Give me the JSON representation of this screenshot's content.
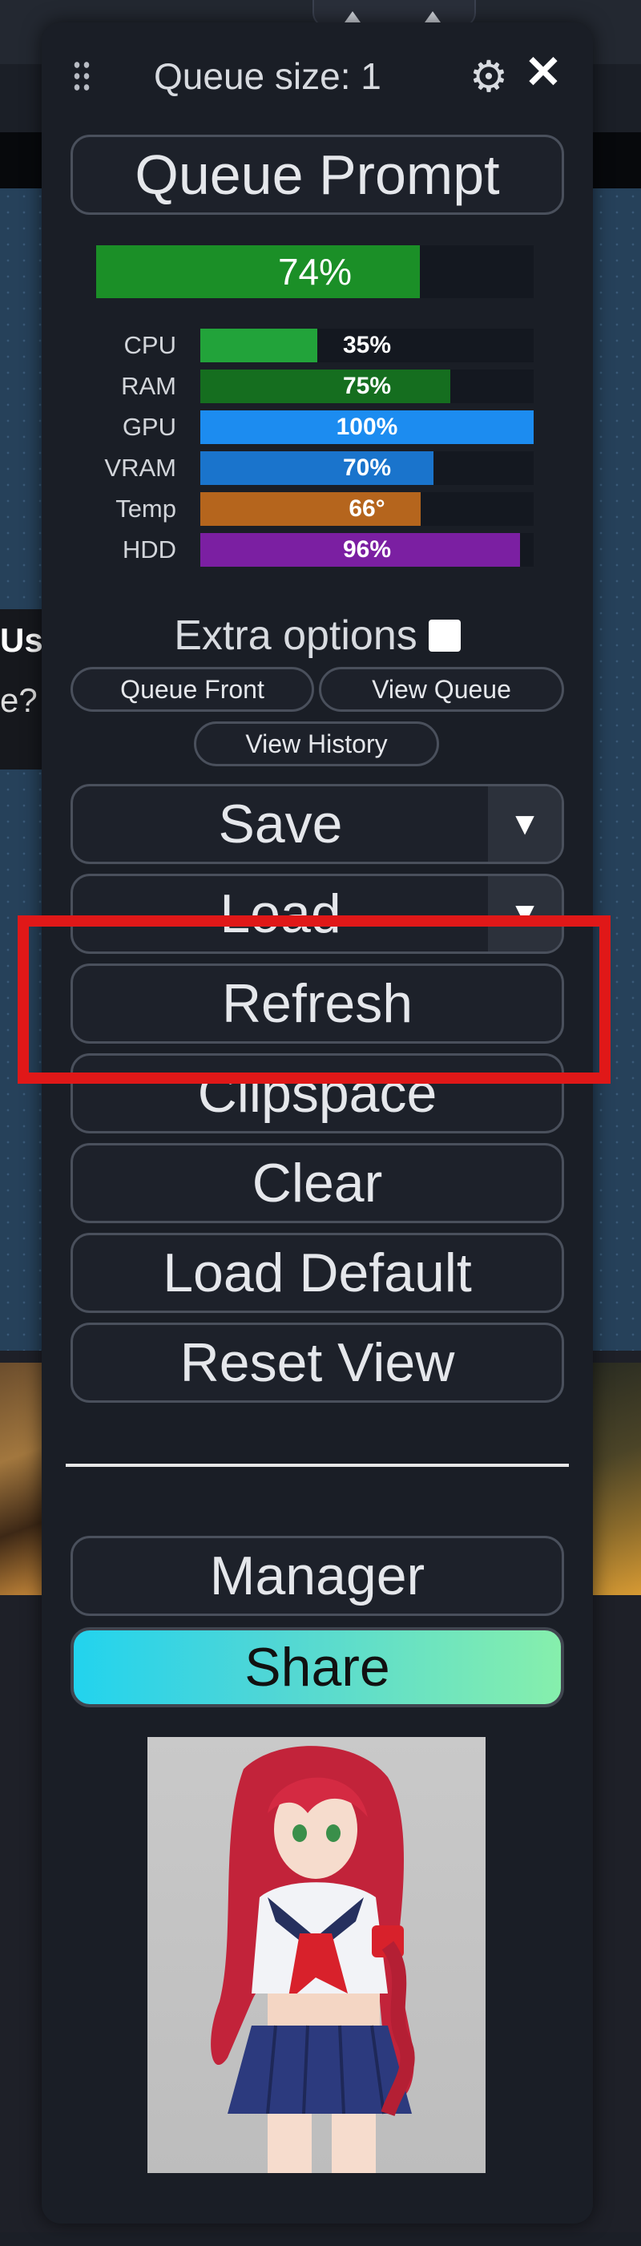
{
  "header": {
    "queue_size": "Queue size: 1",
    "settings_icon": "gear-icon",
    "close_icon": "close-icon",
    "close_glyph": "✕"
  },
  "buttons": {
    "queue_prompt": "Queue Prompt",
    "queue_front": "Queue Front",
    "view_queue": "View Queue",
    "view_history": "View History",
    "save": "Save",
    "load": "Load",
    "refresh": "Refresh",
    "clipspace": "Clipspace",
    "clear": "Clear",
    "load_default": "Load Default",
    "reset_view": "Reset View",
    "manager": "Manager",
    "share": "Share"
  },
  "progress": {
    "percent": 0.74,
    "label": "74%"
  },
  "stats": [
    {
      "label": "CPU",
      "value": "35%",
      "level": 0.35,
      "color": "#22a33a"
    },
    {
      "label": "RAM",
      "value": "75%",
      "level": 0.75,
      "color": "#156e1f"
    },
    {
      "label": "GPU",
      "value": "100%",
      "level": 1.0,
      "color": "#1c8cf0"
    },
    {
      "label": "VRAM",
      "value": "70%",
      "level": 0.7,
      "color": "#1a74cc"
    },
    {
      "label": "Temp",
      "value": "66°",
      "level": 0.66,
      "color": "#b5651d"
    },
    {
      "label": "HDD",
      "value": "96%",
      "level": 0.96,
      "color": "#7b1fa2"
    }
  ],
  "extra_options": {
    "label": "Extra options",
    "checked": false
  },
  "dropdown_glyph": "▼",
  "background": {
    "left_text_1": "Use",
    "left_text_2": "e?"
  }
}
